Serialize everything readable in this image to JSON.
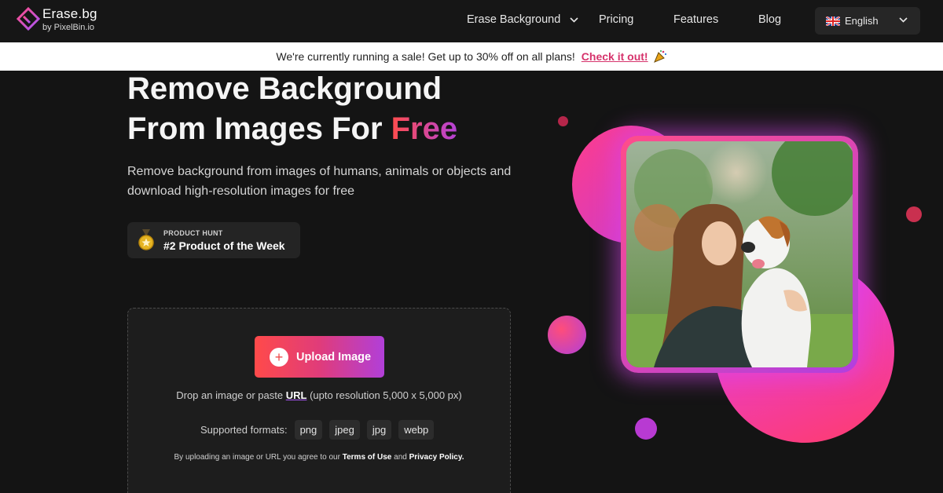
{
  "brand": {
    "name": "Erase.bg",
    "byline": "by PixelBin.io"
  },
  "nav": {
    "items": [
      {
        "label": "Erase Background",
        "has_dropdown": true
      },
      {
        "label": "Pricing"
      },
      {
        "label": "Features"
      },
      {
        "label": "Blog"
      }
    ],
    "language": {
      "label": "English",
      "flag": "uk-flag-icon"
    }
  },
  "banner": {
    "text": "We're currently running a sale! Get up to 30% off on all plans!",
    "link": "Check it out!",
    "emoji": "party-popper-icon"
  },
  "hero": {
    "title_line1": "Remove Background",
    "title_line2_prefix": "From Images For ",
    "title_line2_highlight": "Free",
    "subtitle": "Remove background from images of humans, animals or objects and download high-resolution images for free",
    "badge_small": "PRODUCT HUNT",
    "badge_big": "#2 Product of the Week"
  },
  "upload": {
    "button_label": "Upload Image",
    "drop_prefix": "Drop an image or paste",
    "drop_url": "URL",
    "drop_suffix": "(upto resolution 5,000 x 5,000 px)",
    "formats_label": "Supported formats:",
    "formats": [
      "png",
      "jpeg",
      "jpg",
      "webp"
    ],
    "terms_prefix": "By uploading an image or URL you agree to our",
    "terms_link": "Terms of Use",
    "terms_and": "and",
    "privacy_link": "Privacy Policy."
  },
  "colors": {
    "accent_red": "#ff4a4a",
    "accent_purple": "#b13fd9",
    "banner_link": "#d6336c",
    "background": "#141414"
  }
}
